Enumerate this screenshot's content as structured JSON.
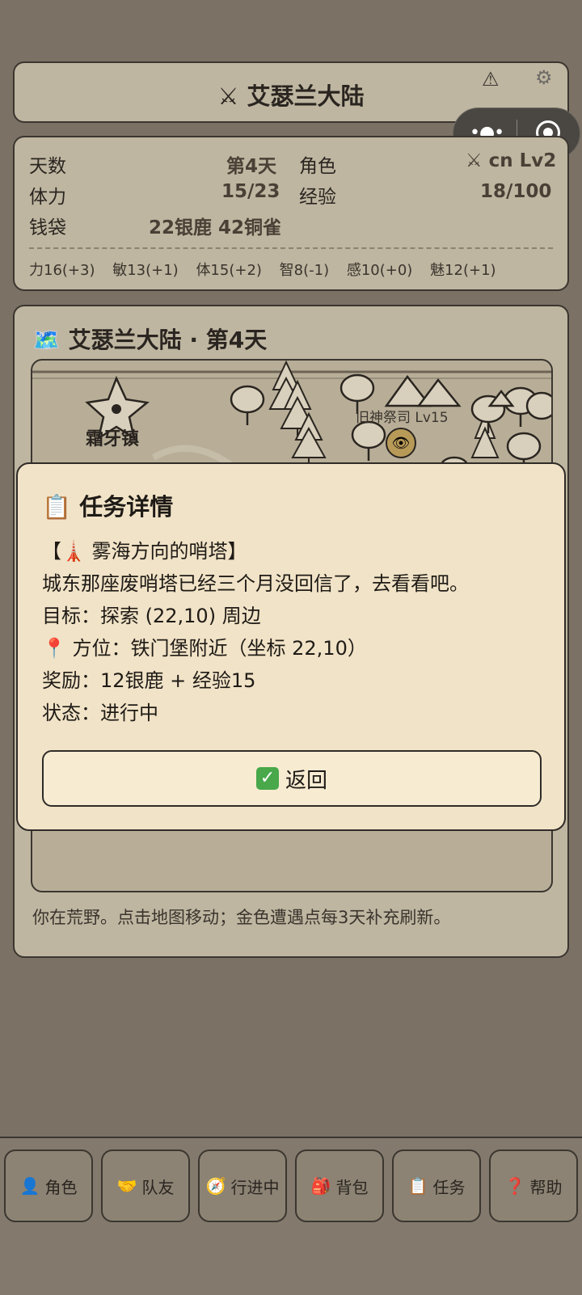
{
  "header": {
    "title": "⚔ 艾瑟兰大陆",
    "warning_icon": "warning-icon",
    "settings_icon": "gear-icon"
  },
  "capsule": {
    "menu_glyph": "•●•",
    "close_icon": "record-icon"
  },
  "stats": {
    "days_label": "天数",
    "days_value": "第4天",
    "role_label": "角色",
    "role_value": "⚔ cn Lv2",
    "stamina_label": "体力",
    "stamina_value": "15/23",
    "exp_label": "经验",
    "exp_value": "18/100",
    "purse_label": "钱袋",
    "purse_value": "22银鹿 42铜雀",
    "attributes": [
      "力16(+3)",
      "敏13(+1)",
      "体15(+2)",
      "智8(-1)",
      "感10(+0)",
      "魅12(+1)"
    ]
  },
  "map": {
    "title": "🗺️ 艾瑟兰大陆 · 第4天",
    "town_label": "霜牙镇",
    "npc_label": "旧神祭司 Lv15",
    "hint": "你在荒野。点击地图移动；金色遭遇点每3天补充刷新。"
  },
  "modal": {
    "title": "📋 任务详情",
    "quest_name": "【🗼 雾海方向的哨塔】",
    "description": "城东那座废哨塔已经三个月没回信了，去看看吧。",
    "objective": "目标：探索 (22,10) 周边",
    "location": "📍 方位：铁门堡附近（坐标 22,10）",
    "reward": "奖励：12银鹿 + 经验15",
    "status": "状态：进行中",
    "back_label": "返回"
  },
  "nav": [
    {
      "icon": "👤",
      "label": "角色"
    },
    {
      "icon": "🤝",
      "label": "队友"
    },
    {
      "icon": "🧭",
      "label": "行进中"
    },
    {
      "icon": "🎒",
      "label": "背包"
    },
    {
      "icon": "📋",
      "label": "任务"
    },
    {
      "icon": "❓",
      "label": "帮助"
    }
  ],
  "colors": {
    "background": "#7b7265",
    "card": "#bfb6a1",
    "modal": "#f1e3c7",
    "border": "#3b3630"
  }
}
